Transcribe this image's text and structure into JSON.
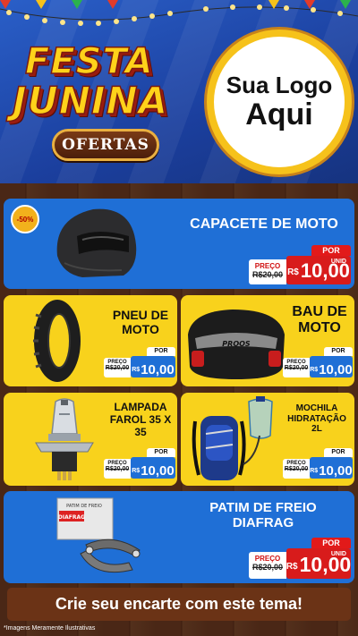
{
  "header": {
    "title_line1": "FESTA",
    "title_line2": "JUNINA",
    "subtitle": "OFERTAS",
    "logo_line1": "Sua Logo",
    "logo_line2": "Aqui"
  },
  "products": [
    {
      "name": "CAPACETE DE MOTO",
      "discount": "-50%",
      "price_label": "PREÇO",
      "old_price": "R$20,00",
      "por_label": "POR",
      "currency": "R$",
      "price": "10,00",
      "unit": "UNID",
      "icon": "helmet-icon"
    },
    {
      "name_line1": "PNEU DE",
      "name_line2": "MOTO",
      "price_label": "PREÇO",
      "old_price": "R$20,00",
      "por_label": "POR",
      "currency": "R$",
      "price": "10,00",
      "icon": "tire-icon"
    },
    {
      "name_line1": "BAU DE",
      "name_line2": "MOTO",
      "price_label": "PREÇO",
      "old_price": "R$20,00",
      "por_label": "POR",
      "currency": "R$",
      "price": "10,00",
      "box_text": "PROOS",
      "icon": "top-case-icon"
    },
    {
      "name_line1": "LAMPADA",
      "name_line2": "FAROL 35 X",
      "name_line3": "35",
      "price_label": "PREÇO",
      "old_price": "R$20,00",
      "por_label": "POR",
      "currency": "R$",
      "price": "10,00",
      "icon": "bulb-icon"
    },
    {
      "name_line1": "MOCHILA",
      "name_line2": "HIDRATAÇÃO",
      "name_line3": "2L",
      "price_label": "PREÇO",
      "old_price": "R$20,00",
      "por_label": "POR",
      "currency": "R$",
      "price": "10,00",
      "icon": "backpack-icon"
    },
    {
      "name_line1": "PATIM DE FREIO",
      "name_line2": "DIAFRAG",
      "price_label": "PREÇO",
      "old_price": "R$20,00",
      "por_label": "POR",
      "currency": "R$",
      "price": "10,00",
      "unit": "UNID",
      "brand": "DIAFRAG",
      "icon": "brake-shoe-icon"
    }
  ],
  "cta": "Crie seu encarte com este tema!",
  "footnote": "*Imagens Meramente Ilustrativas",
  "colors": {
    "blue_card": "#1f6fd6",
    "yellow_card": "#f8d21c",
    "price_red": "#d81b1b",
    "accent_yellow": "#ffd21a"
  }
}
